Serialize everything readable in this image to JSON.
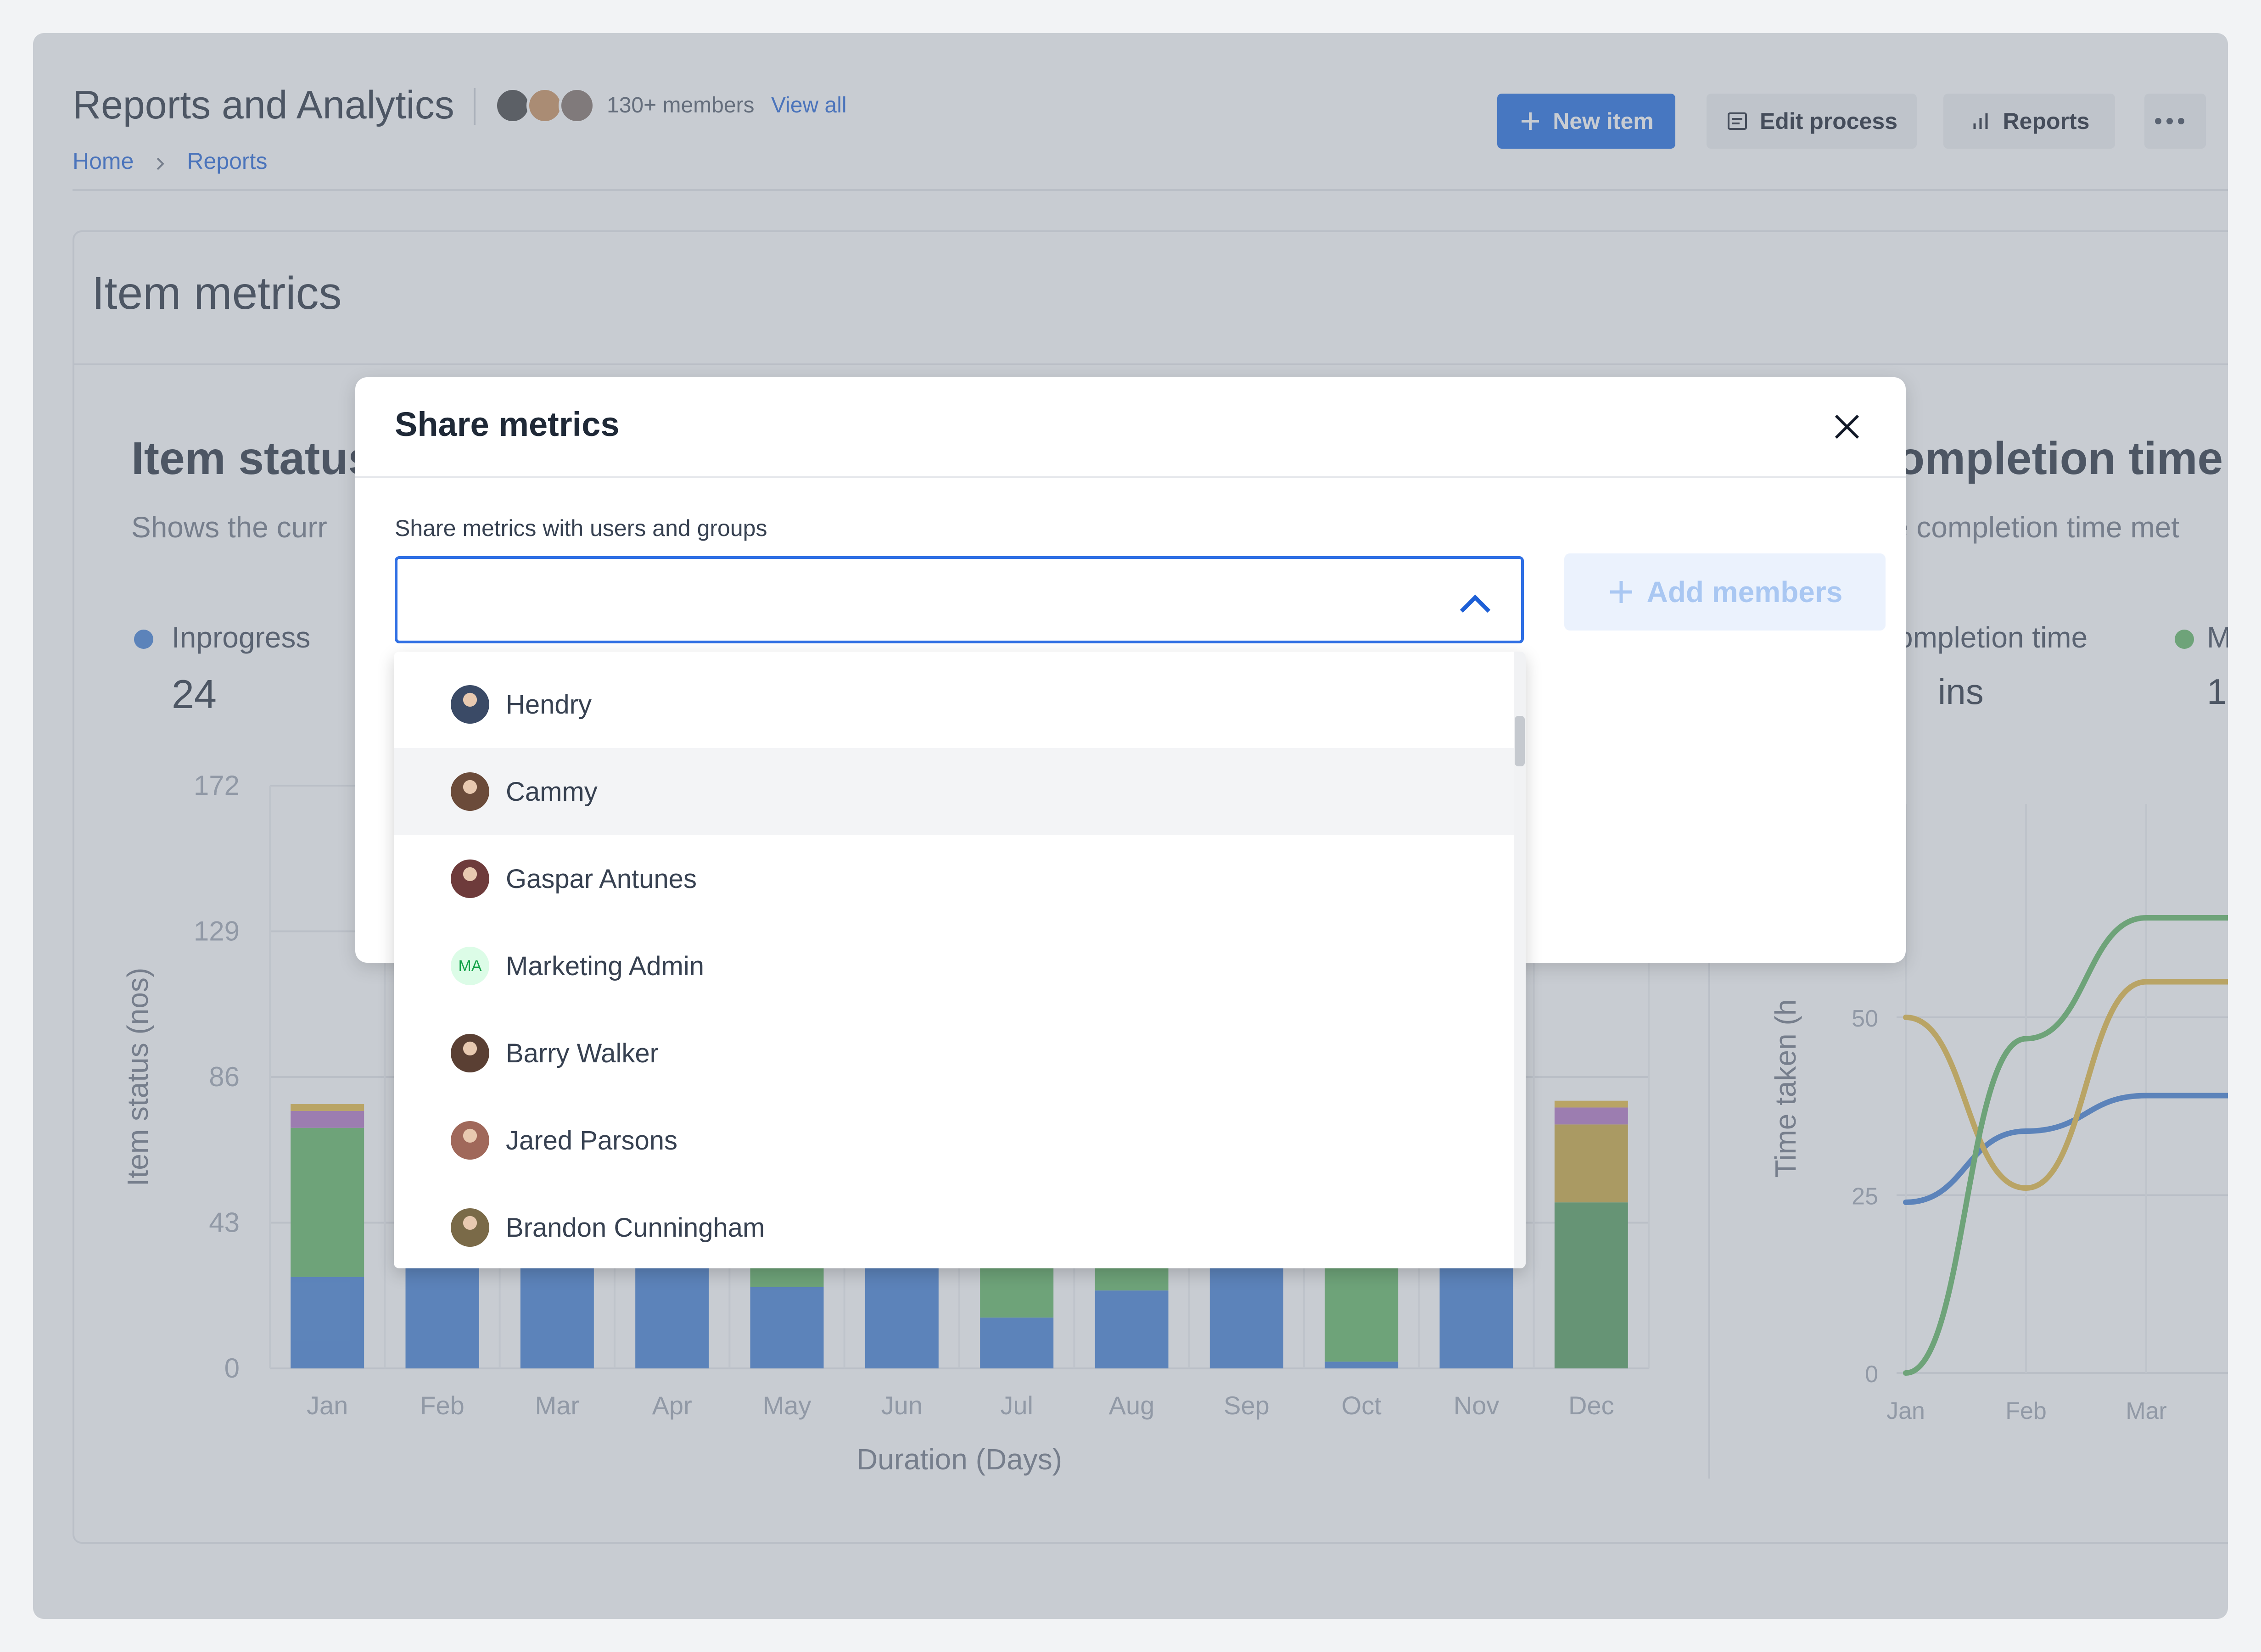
{
  "header": {
    "title": "Reports and Analytics",
    "members_text": "130+ members",
    "view_all": "View all",
    "breadcrumb": [
      "Home",
      "Reports"
    ],
    "buttons": {
      "new_item": "New item",
      "edit_process": "Edit process",
      "reports": "Reports"
    }
  },
  "card": {
    "title": "Item metrics"
  },
  "item_status": {
    "title": "Item status",
    "subtitle": "Shows the curr",
    "legend": [
      {
        "label": "Inprogress",
        "value": "24",
        "color": "#3b7bd4"
      }
    ]
  },
  "completion": {
    "title": "ompletion time",
    "subtitle": "e completion time met",
    "legend_label": "ompletion time",
    "legend_value": "ins",
    "legend2_label": "M",
    "legend2_value": "1"
  },
  "chart_data": [
    {
      "type": "bar",
      "stacked": true,
      "ylabel": "Item status (nos)",
      "xlabel": "Duration (Days)",
      "y_ticks": [
        "0",
        "43",
        "86",
        "129",
        "172"
      ],
      "ylim": [
        0,
        172
      ],
      "categories": [
        "Jan",
        "Feb",
        "Mar",
        "Apr",
        "May",
        "Jun",
        "Jul",
        "Aug",
        "Sep",
        "Oct",
        "Nov",
        "Dec"
      ],
      "series": [
        {
          "color": "#3b7bd4",
          "values": [
            27,
            30,
            30,
            30,
            24,
            30,
            15,
            23,
            30,
            2,
            30,
            0
          ]
        },
        {
          "color": "#5bb55e",
          "values": [
            44,
            5,
            5,
            5,
            12,
            5,
            20,
            12,
            5,
            40,
            5,
            0
          ]
        },
        {
          "color": "#4e9a56",
          "values": [
            0,
            0,
            0,
            0,
            0,
            0,
            0,
            0,
            0,
            0,
            0,
            49
          ]
        },
        {
          "color": "#c8a535",
          "values": [
            0,
            0,
            0,
            0,
            0,
            0,
            0,
            0,
            0,
            0,
            0,
            23
          ]
        },
        {
          "color": "#b06fc1",
          "values": [
            5,
            0,
            0,
            0,
            0,
            0,
            0,
            0,
            0,
            0,
            0,
            5
          ]
        },
        {
          "color": "#e3b63a",
          "values": [
            2,
            0,
            0,
            0,
            0,
            0,
            0,
            0,
            0,
            0,
            0,
            2
          ]
        }
      ],
      "grid": true
    },
    {
      "type": "line",
      "ylabel": "Time taken (h",
      "y_ticks": [
        "0",
        "25",
        "50"
      ],
      "categories": [
        "Jan",
        "Feb",
        "Mar"
      ],
      "series": [
        {
          "color": "#3b7bd4",
          "values": [
            24,
            34,
            39
          ]
        },
        {
          "color": "#e3b63a",
          "values": [
            50,
            26,
            55
          ]
        },
        {
          "color": "#5bb55e",
          "values": [
            0,
            47,
            64
          ]
        }
      ],
      "grid": true
    }
  ],
  "modal": {
    "title": "Share metrics",
    "label": "Share metrics with users and groups",
    "select_value": "",
    "add_members": "Add members",
    "options": [
      {
        "name": "Hendry",
        "avatar": "#3a4a66"
      },
      {
        "name": "Cammy",
        "avatar": "#6b4b3a"
      },
      {
        "name": "Gaspar Antunes",
        "avatar": "#6e3b3b"
      },
      {
        "name": "Marketing Admin",
        "initials": "MA"
      },
      {
        "name": "Barry Walker",
        "avatar": "#5a3f33"
      },
      {
        "name": "Jared Parsons",
        "avatar": "#a0685a"
      },
      {
        "name": "Brandon Cunningham",
        "avatar": "#7a6a48"
      }
    ]
  }
}
